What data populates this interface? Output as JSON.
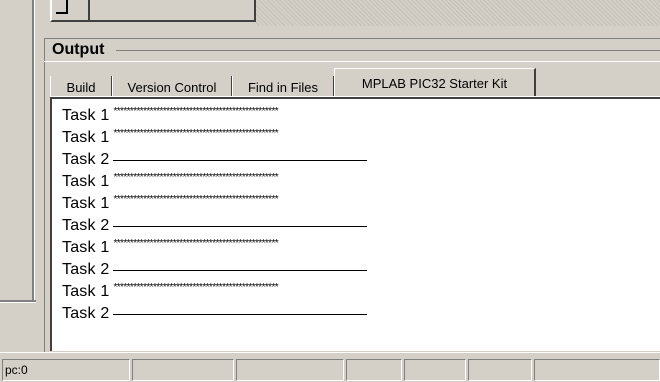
{
  "output": {
    "title": "Output"
  },
  "tabs": [
    {
      "label": "Build"
    },
    {
      "label": "Version Control"
    },
    {
      "label": "Find in Files"
    },
    {
      "label": "MPLAB PIC32 Starter Kit"
    }
  ],
  "lines": [
    {
      "label": "Task 1",
      "stars": "**************************************************"
    },
    {
      "label": "Task 1",
      "stars": "**************************************************"
    },
    {
      "label": "Task 2"
    },
    {
      "label": "Task 1",
      "stars": "**************************************************"
    },
    {
      "label": "Task 1",
      "stars": "**************************************************"
    },
    {
      "label": "Task 2"
    },
    {
      "label": "Task 1",
      "stars": "**************************************************"
    },
    {
      "label": "Task 2"
    },
    {
      "label": "Task 1",
      "stars": "**************************************************"
    },
    {
      "label": "Task 2"
    }
  ],
  "status": {
    "pc": "pc:0"
  }
}
